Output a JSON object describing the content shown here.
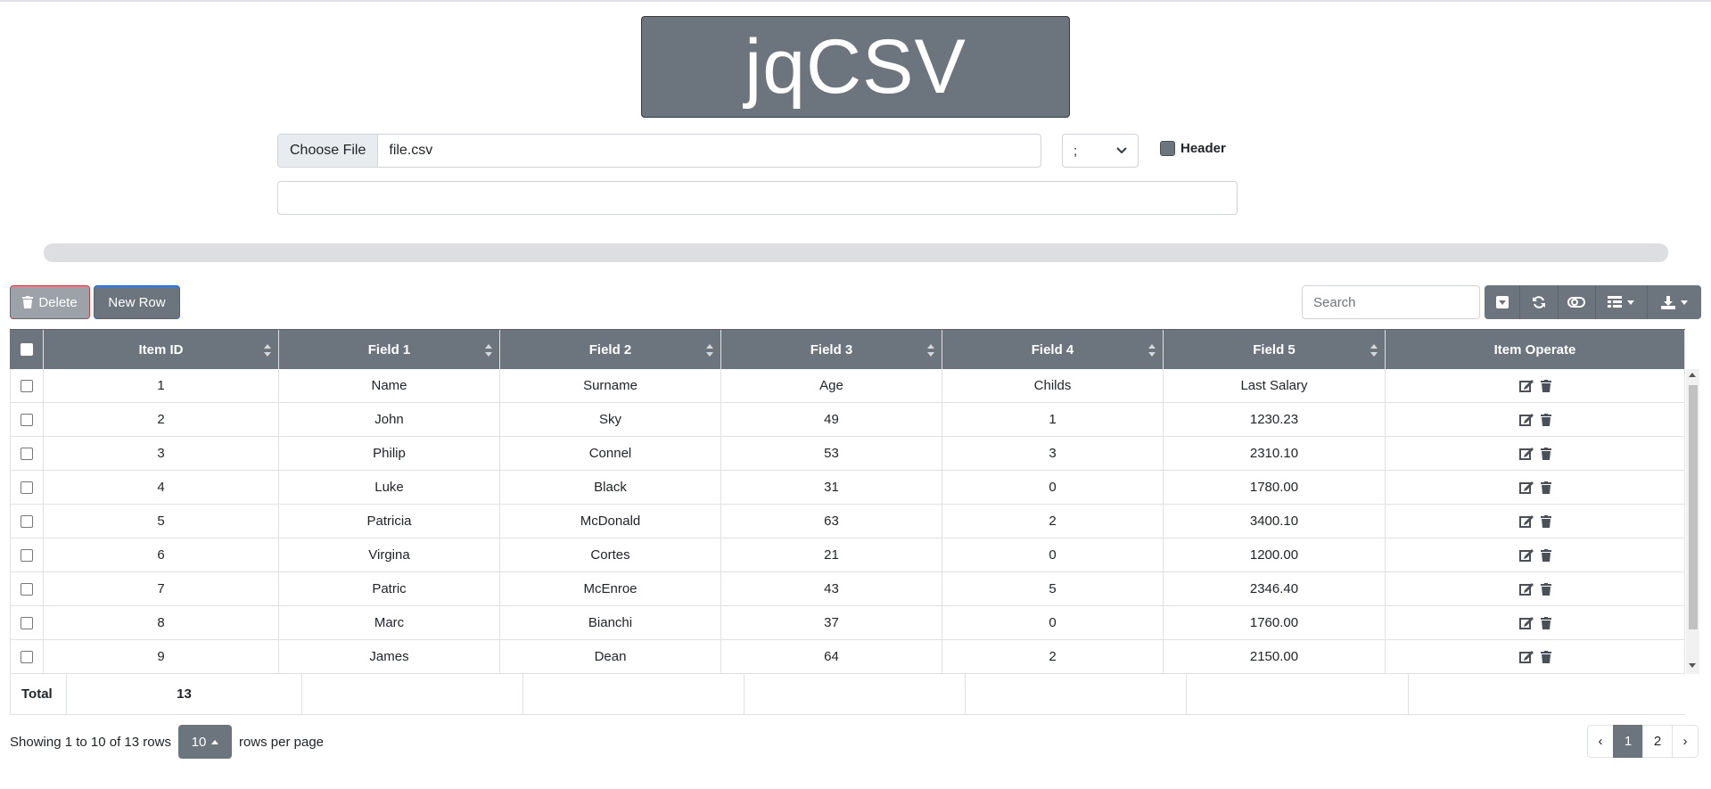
{
  "logo": {
    "text": "jqCSV"
  },
  "file_input": {
    "button_label": "Choose File",
    "file_name": "file.csv"
  },
  "separator": {
    "selected": ";"
  },
  "header_option": {
    "label": "Header"
  },
  "toolbar": {
    "delete_label": "Delete",
    "new_row_label": "New Row",
    "search_placeholder": "Search",
    "tools": [
      "caret-square-down-icon",
      "refresh-icon",
      "toggle-icon",
      "columns-icon",
      "export-icon"
    ]
  },
  "table": {
    "columns": [
      "Item ID",
      "Field 1",
      "Field 2",
      "Field 3",
      "Field 4",
      "Field 5",
      "Item Operate"
    ],
    "rows": [
      [
        "1",
        "Name",
        "Surname",
        "Age",
        "Childs",
        "Last Salary"
      ],
      [
        "2",
        "John",
        "Sky",
        "49",
        "1",
        "1230.23"
      ],
      [
        "3",
        "Philip",
        "Connel",
        "53",
        "3",
        "2310.10"
      ],
      [
        "4",
        "Luke",
        "Black",
        "31",
        "0",
        "1780.00"
      ],
      [
        "5",
        "Patricia",
        "McDonald",
        "63",
        "2",
        "3400.10"
      ],
      [
        "6",
        "Virgina",
        "Cortes",
        "21",
        "0",
        "1200.00"
      ],
      [
        "7",
        "Patric",
        "McEnroe",
        "43",
        "5",
        "2346.40"
      ],
      [
        "8",
        "Marc",
        "Bianchi",
        "37",
        "0",
        "1760.00"
      ],
      [
        "9",
        "James",
        "Dean",
        "64",
        "2",
        "2150.00"
      ]
    ],
    "footer": {
      "label": "Total",
      "value": "13"
    }
  },
  "pagination": {
    "showing_text": "Showing 1 to 10 of 13 rows",
    "page_size": "10",
    "rows_per_page_text": "rows per page",
    "prev": "‹",
    "pages": [
      "1",
      "2"
    ],
    "next": "›",
    "active_page": "1"
  },
  "colors": {
    "secondary": "#6c757d",
    "danger": "#dc3545",
    "primary": "#0d6efd"
  }
}
